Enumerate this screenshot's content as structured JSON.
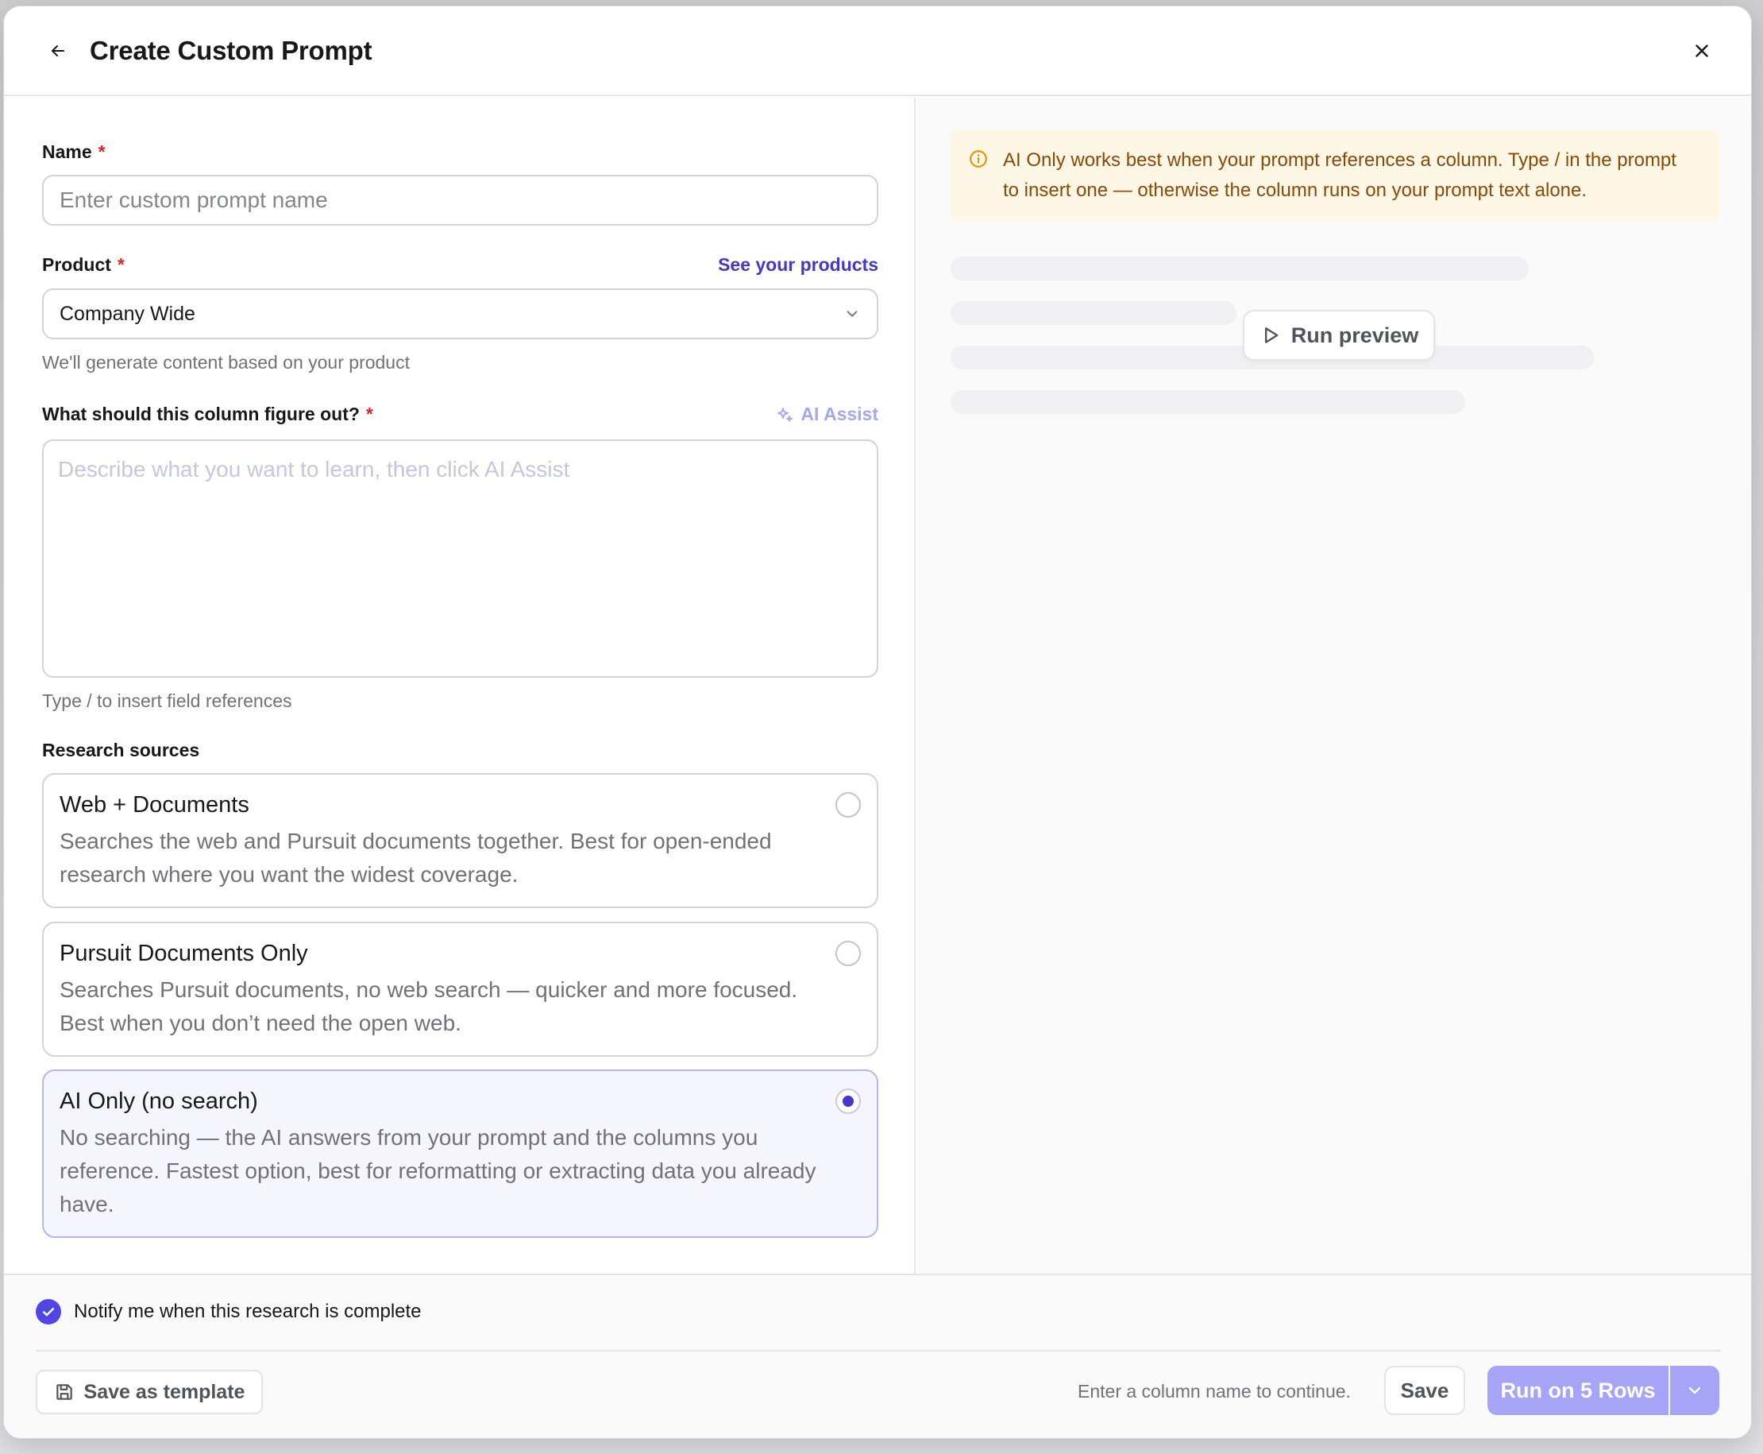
{
  "header": {
    "title": "Create Custom Prompt"
  },
  "form": {
    "name": {
      "label": "Name",
      "required_mark": "*",
      "placeholder": "Enter custom prompt name",
      "value": ""
    },
    "product": {
      "label": "Product",
      "required_mark": "*",
      "link": "See your products",
      "selected": "Company Wide",
      "helper": "We'll generate content based on your product"
    },
    "question": {
      "label": "What should this column figure out?",
      "required_mark": "*",
      "ai_assist_label": "AI Assist",
      "placeholder": "Describe what you want to learn, then click AI Assist",
      "value": "",
      "helper": "Type / to insert field references"
    },
    "research_sources": {
      "label": "Research sources",
      "options": [
        {
          "title": "Web + Documents",
          "description": "Searches the web and Pursuit documents together. Best for open-ended research where you want the widest coverage.",
          "selected": false
        },
        {
          "title": "Pursuit Documents Only",
          "description": "Searches Pursuit documents, no web search — quicker and more focused. Best when you don’t need the open web.",
          "selected": false
        },
        {
          "title": "AI Only (no search)",
          "description": "No searching — the AI answers from your prompt and the columns you reference. Fastest option, best for reformatting or extracting data you already have.",
          "selected": true
        }
      ]
    }
  },
  "preview": {
    "notice_line1": "AI Only works best when your prompt references a column. Type  /  in the prompt",
    "notice_line2": "to insert one — otherwise the column runs on your prompt text alone.",
    "run_preview_label": "Run preview"
  },
  "footer": {
    "notify_label": "Notify me when this research is complete",
    "notify_checked": true,
    "save_template_label": "Save as template",
    "continue_hint": "Enter a column name to continue.",
    "save_label": "Save",
    "run_label": "Run on 5 Rows"
  },
  "colors": {
    "accent": "#4f46e5",
    "accent_disabled": "#a5a4f6",
    "required": "#dc2626",
    "notice_bg": "#fef7e6",
    "notice_text": "#8a4a06"
  },
  "icons": {
    "back": "arrow-left-icon",
    "close": "close-icon",
    "chevron": "chevron-down-icon",
    "ai_assist": "sparkles-icon",
    "info": "info-icon",
    "play": "play-icon",
    "check": "check-icon",
    "save": "floppy-disk-icon"
  }
}
